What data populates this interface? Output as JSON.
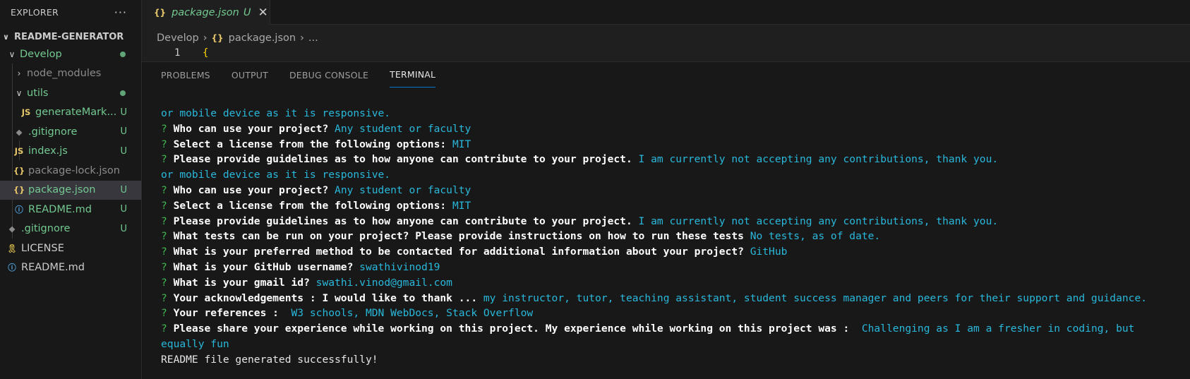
{
  "sidebar": {
    "title": "EXPLORER",
    "more": "···",
    "root": "README-GENERATOR",
    "items": [
      {
        "label": "Develop",
        "badge": ""
      },
      {
        "label": "node_modules",
        "badge": ""
      },
      {
        "label": "utils",
        "badge": ""
      },
      {
        "label": "generateMark...",
        "icon": "JS",
        "badge": "U"
      },
      {
        "label": ".gitignore",
        "icon": "◆",
        "badge": "U"
      },
      {
        "label": "index.js",
        "icon": "JS",
        "badge": "U"
      },
      {
        "label": "package-lock.json",
        "icon": "{}",
        "badge": ""
      },
      {
        "label": "package.json",
        "icon": "{}",
        "badge": "U"
      },
      {
        "label": "README.md",
        "icon": "ⓘ",
        "badge": "U"
      },
      {
        "label": ".gitignore",
        "icon": "◆",
        "badge": "U"
      },
      {
        "label": "LICENSE",
        "icon": "🎗",
        "badge": ""
      },
      {
        "label": "README.md",
        "icon": "ⓘ",
        "badge": ""
      }
    ]
  },
  "tab": {
    "icon": "{}",
    "label": "package.json",
    "badge": "U",
    "close": "✕"
  },
  "breadcrumb": {
    "folder": "Develop",
    "icon": "{}",
    "file": "package.json",
    "sep": "›",
    "more": "..."
  },
  "editor": {
    "line_no": "1",
    "code": "{"
  },
  "panel": {
    "tabs": [
      "PROBLEMS",
      "OUTPUT",
      "DEBUG CONSOLE",
      "TERMINAL"
    ]
  },
  "terminal": {
    "lines": [
      {
        "q": "",
        "b": "",
        "a": "or mobile device as it is responsive."
      },
      {
        "q": "? ",
        "b": "Who can use your project? ",
        "a": "Any student or faculty"
      },
      {
        "q": "? ",
        "b": "Select a license from the following options: ",
        "a": "MIT"
      },
      {
        "q": "? ",
        "b": "Please provide guidelines as to how anyone can contribute to your project. ",
        "a": "I am currently not accepting any contributions, thank you."
      },
      {
        "q": "",
        "b": "",
        "a": "or mobile device as it is responsive."
      },
      {
        "q": "? ",
        "b": "Who can use your project? ",
        "a": "Any student or faculty"
      },
      {
        "q": "? ",
        "b": "Select a license from the following options: ",
        "a": "MIT"
      },
      {
        "q": "? ",
        "b": "Please provide guidelines as to how anyone can contribute to your project. ",
        "a": "I am currently not accepting any contributions, thank you."
      },
      {
        "q": "? ",
        "b": "What tests can be run on your project? Please provide instructions on how to run these tests ",
        "a": "No tests, as of date."
      },
      {
        "q": "? ",
        "b": "What is your preferred method to be contacted for additional information about your project? ",
        "a": "GitHub"
      },
      {
        "q": "? ",
        "b": "What is your GitHub username? ",
        "a": "swathivinod19"
      },
      {
        "q": "? ",
        "b": "What is your gmail id? ",
        "a": "swathi.vinod@gmail.com"
      },
      {
        "q": "? ",
        "b": "Your acknowledgements : I would like to thank ... ",
        "a": "my instructor, tutor, teaching assistant, student success manager and peers for their support and guidance."
      },
      {
        "q": "? ",
        "b": "Your references :  ",
        "a": "W3 schools, MDN WebDocs, Stack Overflow"
      },
      {
        "q": "? ",
        "b": "Please share your experience while working on this project. My experience while working on this project was :  ",
        "a": "Challenging as I am a fresher in coding, but"
      },
      {
        "q": "",
        "b": "",
        "a": "equally fun"
      },
      {
        "q": "",
        "b": "",
        "a": "",
        "w": "README file generated successfully!"
      }
    ]
  }
}
